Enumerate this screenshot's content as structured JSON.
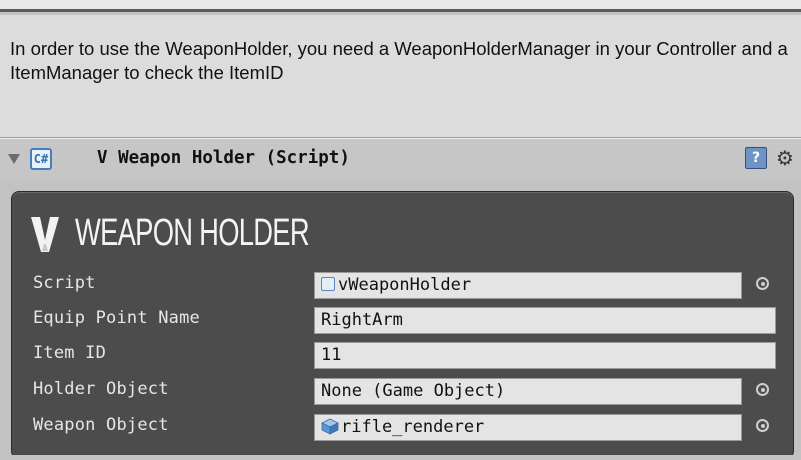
{
  "helpbox": {
    "text": "In order to use the WeaponHolder, you need a WeaponHolderManager in your Controller and a ItemManager to check the ItemID"
  },
  "component": {
    "title": "V Weapon Holder (Script)",
    "script_icon_glyph": "C#",
    "help_icon_glyph": "?",
    "gear_icon_glyph": "⚙"
  },
  "panel": {
    "title": "WEAPON HOLDER",
    "logo": "V",
    "properties": [
      {
        "label": "Script",
        "value": "vWeaponHolder",
        "icon": "script-icon",
        "picker": true
      },
      {
        "label": "Equip Point Name",
        "value": "RightArm",
        "icon": null,
        "picker": false
      },
      {
        "label": "Item ID",
        "value": "11",
        "icon": null,
        "picker": false
      },
      {
        "label": "Holder Object",
        "value": "None (Game Object)",
        "icon": null,
        "picker": true
      },
      {
        "label": "Weapon Object",
        "value": "rifle_renderer",
        "icon": "cube-icon",
        "picker": true
      }
    ]
  },
  "colors": {
    "panel_bg": "#4c4c4c",
    "field_bg": "#e4e4e4",
    "accent_blue": "#4a7db8"
  }
}
